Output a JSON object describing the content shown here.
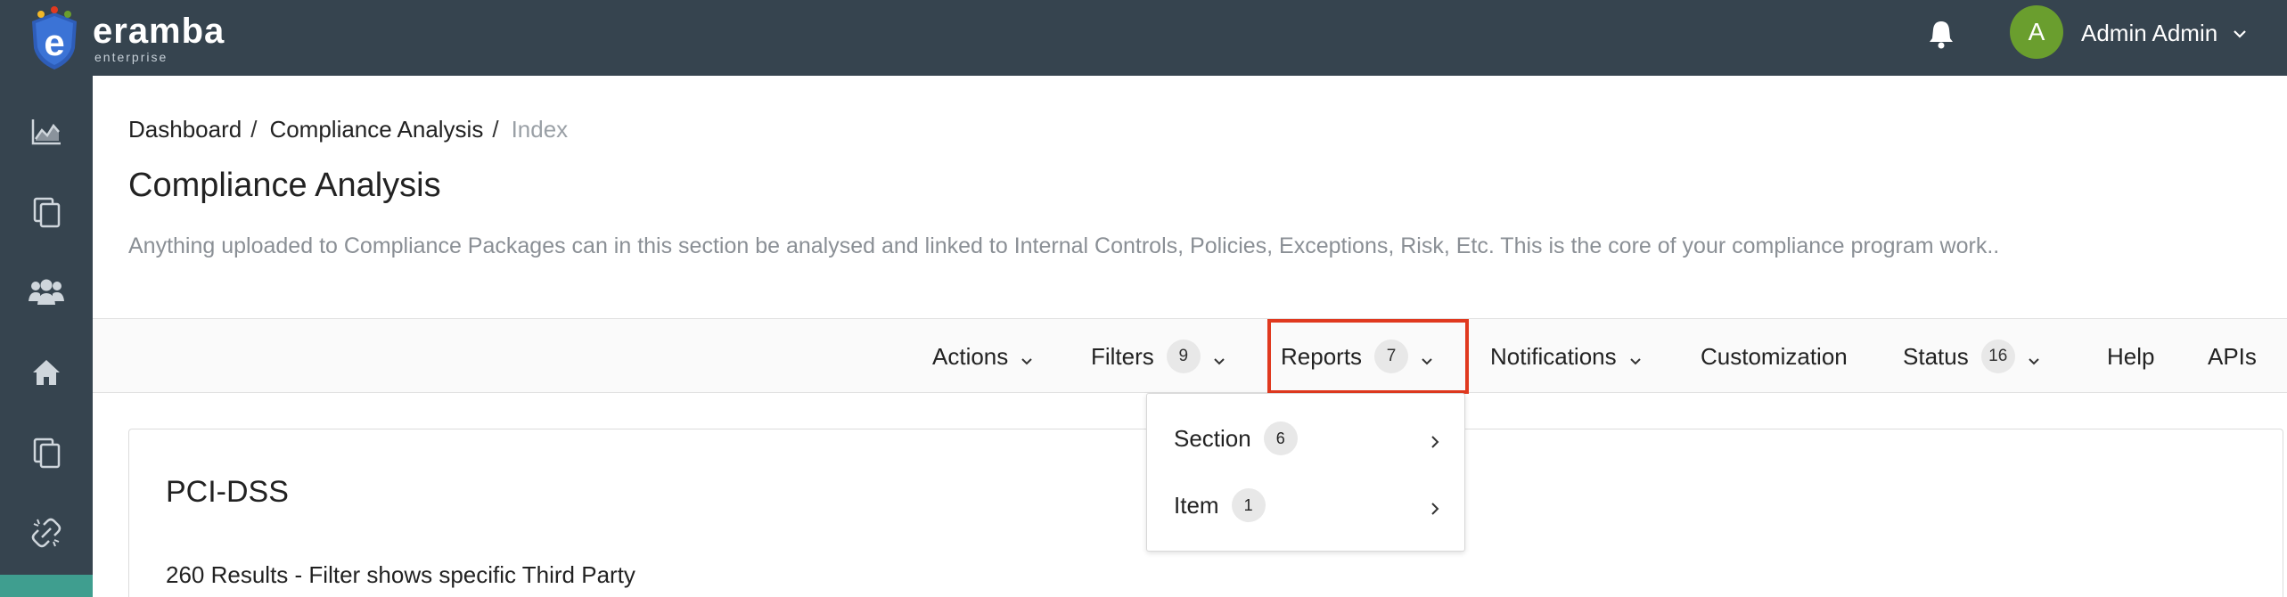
{
  "brand": {
    "name": "eramba",
    "edition": "enterprise"
  },
  "user": {
    "initial": "A",
    "name": "Admin Admin"
  },
  "sidebar": {
    "items": [
      {
        "icon": "chart-icon"
      },
      {
        "icon": "copy-icon"
      },
      {
        "icon": "users-icon"
      },
      {
        "icon": "home-icon"
      },
      {
        "icon": "copy-icon"
      },
      {
        "icon": "broken-link-icon"
      }
    ]
  },
  "breadcrumb": {
    "items": [
      "Dashboard",
      "Compliance Analysis"
    ],
    "current": "Index",
    "separator": "/"
  },
  "page": {
    "title": "Compliance Analysis",
    "description": "Anything uploaded to Compliance Packages can in this section be analysed and linked to Internal Controls, Policies, Exceptions, Risk, Etc. This is the core of your compliance program work.."
  },
  "toolbar": {
    "actions": "Actions",
    "filters": "Filters",
    "filters_count": "9",
    "reports": "Reports",
    "reports_count": "7",
    "notifications": "Notifications",
    "customization": "Customization",
    "status": "Status",
    "status_count": "16",
    "help": "Help",
    "apis": "APIs"
  },
  "reports_menu": {
    "items": [
      {
        "label": "Section",
        "count": "6"
      },
      {
        "label": "Item",
        "count": "1"
      }
    ]
  },
  "card": {
    "title": "PCI-DSS",
    "results": "260 Results - Filter shows specific Third Party"
  },
  "colors": {
    "topbar": "#36444f",
    "avatar": "#6a9e2e",
    "highlight": "#e0391f",
    "sidebar_accent": "#3f9e8f"
  }
}
